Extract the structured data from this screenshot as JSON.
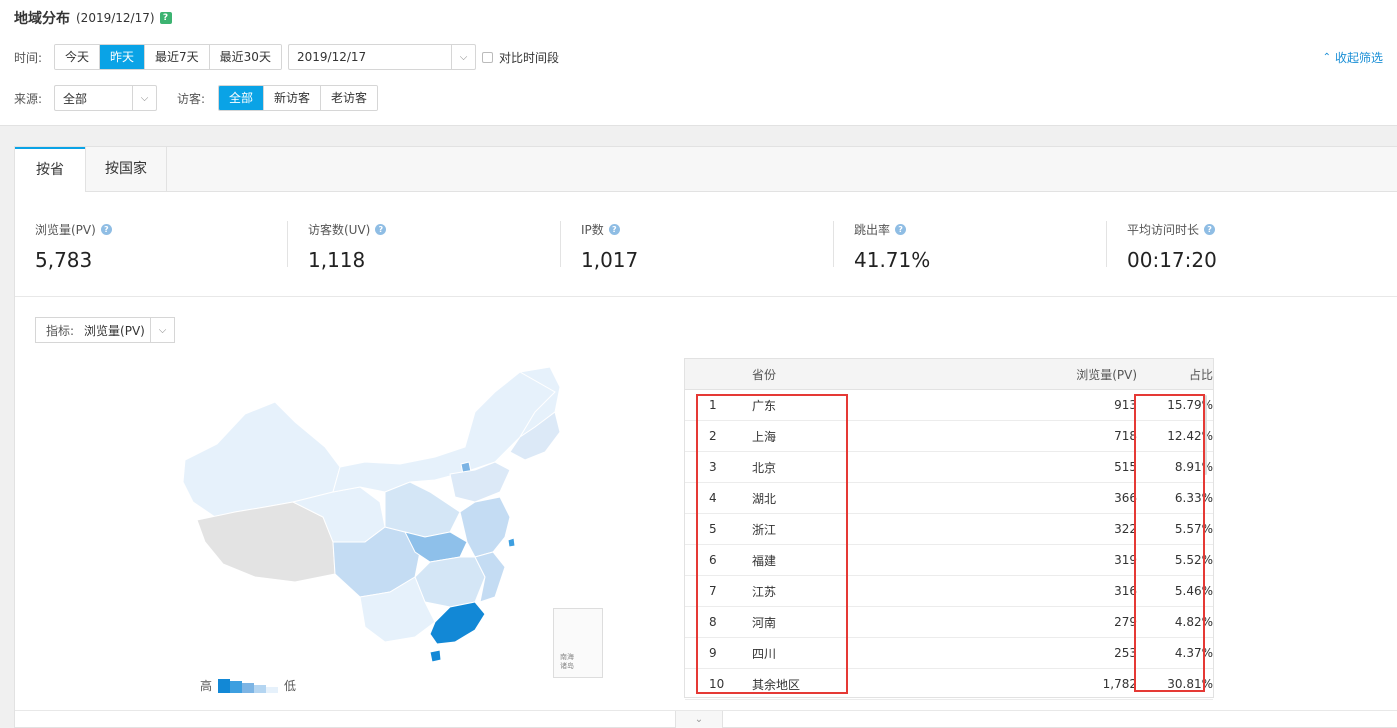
{
  "header": {
    "title": "地域分布",
    "date": "(2019/12/17)",
    "help": "?"
  },
  "filters": {
    "time_label": "时间:",
    "time_buttons": [
      "今天",
      "昨天",
      "最近7天",
      "最近30天"
    ],
    "date_value": "2019/12/17",
    "compare_label": "对比时间段",
    "collapse_label": "收起筛选",
    "source_label": "来源:",
    "source_value": "全部",
    "visitor_label": "访客:",
    "visitor_buttons": [
      "全部",
      "新访客",
      "老访客"
    ]
  },
  "tabs": [
    "按省",
    "按国家"
  ],
  "metrics": [
    {
      "label": "浏览量(PV)",
      "value": "5,783"
    },
    {
      "label": "访客数(UV)",
      "value": "1,118"
    },
    {
      "label": "IP数",
      "value": "1,017"
    },
    {
      "label": "跳出率",
      "value": "41.71%"
    },
    {
      "label": "平均访问时长",
      "value": "00:17:20"
    }
  ],
  "metric_select": {
    "label": "指标:",
    "value": "浏览量(PV)"
  },
  "legend": {
    "high": "高",
    "low": "低"
  },
  "south_sea": {
    "line1": "南海",
    "line2": "诸岛"
  },
  "table": {
    "headers": {
      "province": "省份",
      "pv": "浏览量(PV)",
      "ratio": "占比"
    },
    "rows": [
      {
        "rank": "1",
        "province": "广东",
        "pv": "913",
        "ratio": "15.79%"
      },
      {
        "rank": "2",
        "province": "上海",
        "pv": "718",
        "ratio": "12.42%"
      },
      {
        "rank": "3",
        "province": "北京",
        "pv": "515",
        "ratio": "8.91%"
      },
      {
        "rank": "4",
        "province": "湖北",
        "pv": "366",
        "ratio": "6.33%"
      },
      {
        "rank": "5",
        "province": "浙江",
        "pv": "322",
        "ratio": "5.57%"
      },
      {
        "rank": "6",
        "province": "福建",
        "pv": "319",
        "ratio": "5.52%"
      },
      {
        "rank": "7",
        "province": "江苏",
        "pv": "316",
        "ratio": "5.46%"
      },
      {
        "rank": "8",
        "province": "河南",
        "pv": "279",
        "ratio": "4.82%"
      },
      {
        "rank": "9",
        "province": "四川",
        "pv": "253",
        "ratio": "4.37%"
      },
      {
        "rank": "10",
        "province": "其余地区",
        "pv": "1,782",
        "ratio": "30.81%"
      }
    ]
  },
  "colors": {
    "accent": "#0aa3e6",
    "highlight": "#e53935",
    "map_high": "#1288d6",
    "map_low": "#e6f1fb"
  }
}
